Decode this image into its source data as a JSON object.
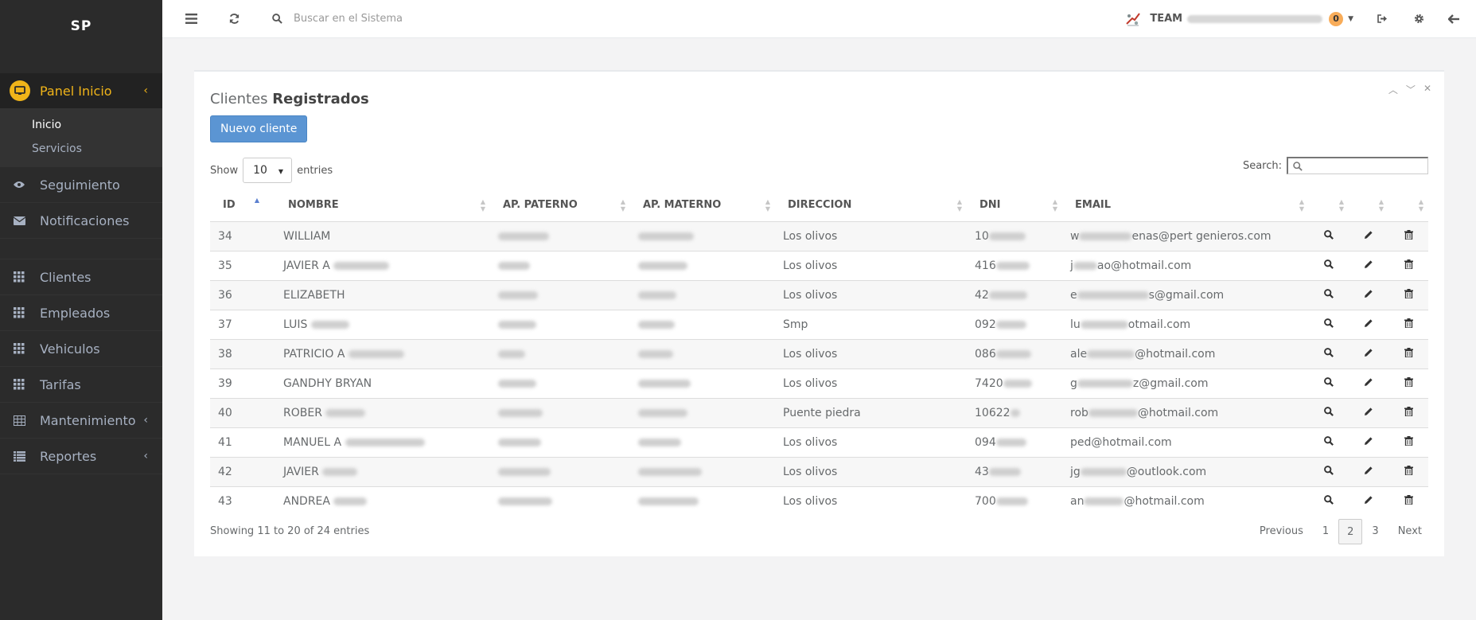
{
  "sidebar": {
    "brand": "SP",
    "active": {
      "label": "Panel Inicio",
      "sub": [
        "Inicio",
        "Servicios"
      ]
    },
    "items_top": [
      {
        "label": "Seguimiento",
        "icon": "eye-icon"
      },
      {
        "label": "Notificaciones",
        "icon": "envelope-icon"
      }
    ],
    "items_bottom": [
      {
        "label": "Clientes",
        "icon": "grid-icon",
        "chev": false
      },
      {
        "label": "Empleados",
        "icon": "grid-icon",
        "chev": false
      },
      {
        "label": "Vehiculos",
        "icon": "grid-icon",
        "chev": false
      },
      {
        "label": "Tarifas",
        "icon": "grid-icon",
        "chev": false
      },
      {
        "label": "Mantenimiento",
        "icon": "table-icon",
        "chev": true
      },
      {
        "label": "Reportes",
        "icon": "list-icon",
        "chev": true
      }
    ]
  },
  "topbar": {
    "search_placeholder": "Buscar en el Sistema",
    "team_label": "TEAM",
    "notif_count": "0"
  },
  "panel": {
    "title_light": "Clientes",
    "title_bold": "Registrados",
    "new_button": "Nuevo cliente",
    "show_label": "Show",
    "entries_label": "entries",
    "length_value": "10",
    "search_label": "Search:"
  },
  "table": {
    "columns": [
      "ID",
      "NOMBRE",
      "AP. PATERNO",
      "AP. MATERNO",
      "DIRECCION",
      "DNI",
      "EMAIL"
    ],
    "rows": [
      {
        "id": "34",
        "nombre": "WILLIAM",
        "direccion": "Los olivos",
        "dni": "10",
        "email_pre": "w",
        "email_post": "enas@pert genieros.com"
      },
      {
        "id": "35",
        "nombre": "JAVIER A",
        "direccion": "Los olivos",
        "dni": "416",
        "email_pre": "j",
        "email_post": "ao@hotmail.com"
      },
      {
        "id": "36",
        "nombre": "ELIZABETH",
        "direccion": "Los olivos",
        "dni": "42",
        "email_pre": "e",
        "email_post": "s@gmail.com"
      },
      {
        "id": "37",
        "nombre": "LUIS",
        "direccion": "Smp",
        "dni": "092",
        "email_pre": "lu",
        "email_post": "otmail.com"
      },
      {
        "id": "38",
        "nombre": "PATRICIO A",
        "direccion": "Los olivos",
        "dni": "086",
        "email_pre": "ale",
        "email_post": "@hotmail.com"
      },
      {
        "id": "39",
        "nombre": "GANDHY BRYAN",
        "direccion": "Los olivos",
        "dni": "7420",
        "email_pre": "g",
        "email_post": "z@gmail.com"
      },
      {
        "id": "40",
        "nombre": "ROBER",
        "direccion": "Puente piedra",
        "dni": "10622",
        "email_pre": "rob",
        "email_post": "@hotmail.com"
      },
      {
        "id": "41",
        "nombre": "MANUEL A",
        "direccion": "Los olivos",
        "dni": "094",
        "email_pre": "",
        "email_post": "ped@hotmail.com"
      },
      {
        "id": "42",
        "nombre": "JAVIER",
        "direccion": "Los olivos",
        "dni": "43",
        "email_pre": "jg",
        "email_post": "@outlook.com"
      },
      {
        "id": "43",
        "nombre": "ANDREA",
        "direccion": "Los olivos",
        "dni": "700",
        "email_pre": "an",
        "email_post": "@hotmail.com"
      }
    ]
  },
  "footer": {
    "info": "Showing 11 to 20 of 24 entries",
    "prev": "Previous",
    "pages": [
      "1",
      "2",
      "3"
    ],
    "current": "2",
    "next": "Next"
  },
  "colors": {
    "accent": "#f0b419",
    "sidebar": "#2b2b2b",
    "button": "#5b95d3"
  }
}
